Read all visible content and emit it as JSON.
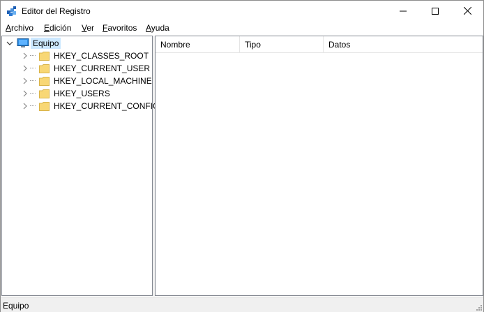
{
  "window": {
    "title": "Editor del Registro"
  },
  "menu": [
    {
      "accel": "A",
      "rest": "rchivo"
    },
    {
      "accel": "E",
      "rest": "dición"
    },
    {
      "accel": "V",
      "rest": "er"
    },
    {
      "accel": "F",
      "rest": "avoritos"
    },
    {
      "accel": "A",
      "rest": "yuda"
    }
  ],
  "tree": {
    "root": {
      "label": "Equipo",
      "icon": "computer-icon",
      "expanded": true
    },
    "children": [
      {
        "label": "HKEY_CLASSES_ROOT",
        "icon": "folder-icon"
      },
      {
        "label": "HKEY_CURRENT_USER",
        "icon": "folder-icon"
      },
      {
        "label": "HKEY_LOCAL_MACHINE",
        "icon": "folder-icon"
      },
      {
        "label": "HKEY_USERS",
        "icon": "folder-icon"
      },
      {
        "label": "HKEY_CURRENT_CONFIG",
        "icon": "folder-icon"
      }
    ]
  },
  "list": {
    "columns": [
      "Nombre",
      "Tipo",
      "Datos"
    ]
  },
  "status": {
    "text": "Equipo"
  },
  "colors": {
    "selection": "#cce8ff",
    "folder": "#f8d775",
    "accent": "#0078d7"
  }
}
